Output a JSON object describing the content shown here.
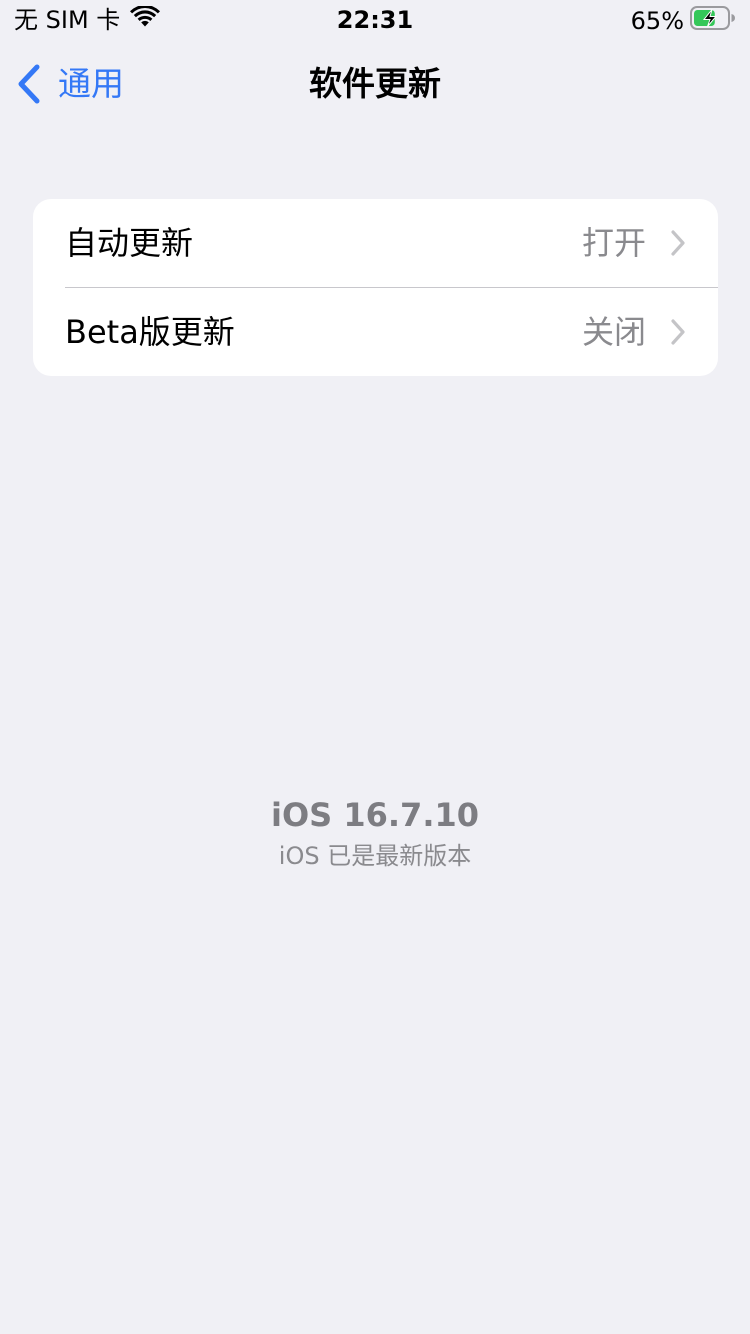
{
  "status_bar": {
    "carrier": "无 SIM 卡",
    "time": "22:31",
    "battery_percent": "65%",
    "battery_level": 0.65,
    "charging": true,
    "icons": [
      "wifi-icon",
      "battery-charging-icon"
    ]
  },
  "nav": {
    "back_label": "通用",
    "title": "软件更新"
  },
  "settings": {
    "rows": [
      {
        "label": "自动更新",
        "value": "打开"
      },
      {
        "label": "Beta版更新",
        "value": "关闭"
      }
    ]
  },
  "version": {
    "title": "iOS 16.7.10",
    "subtitle": "iOS 已是最新版本"
  },
  "colors": {
    "background": "#f0f0f5",
    "accent": "#3478f6",
    "secondary_text": "#8a8a8e",
    "battery_green": "#34c759"
  }
}
